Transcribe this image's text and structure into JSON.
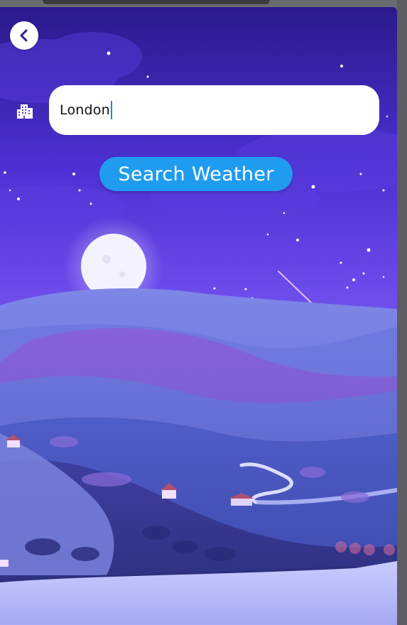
{
  "search": {
    "value": "London"
  },
  "button": {
    "label": "Search Weather"
  },
  "icons": {
    "back": "chevron-left-icon",
    "city": "city-buildings-icon"
  },
  "colors": {
    "accent": "#1f9cf0",
    "sky_top": "#2a1f8f",
    "sky_mid": "#5b3fe0",
    "hills": "#4a55c8"
  }
}
